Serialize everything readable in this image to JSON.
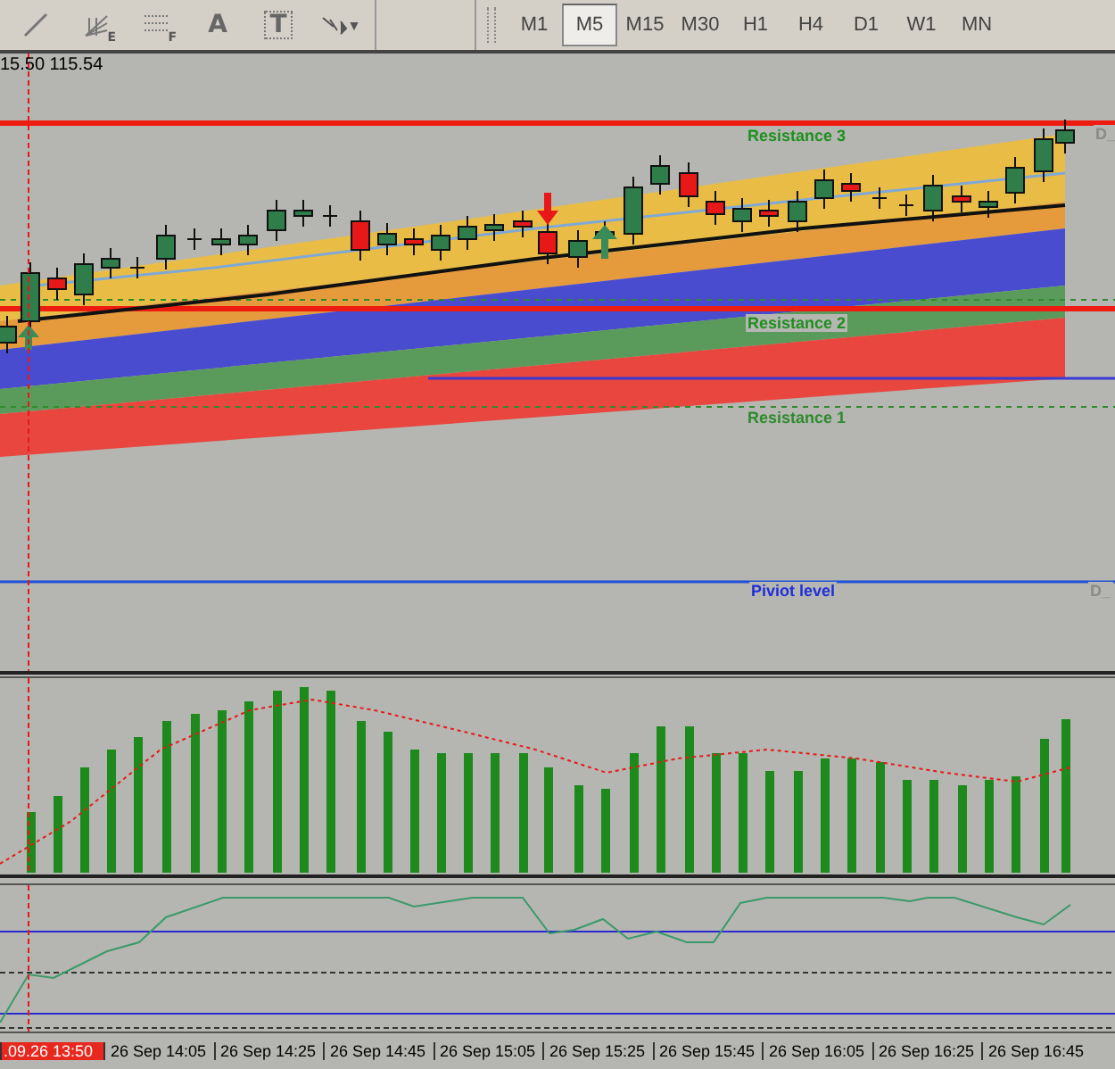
{
  "toolbar": {
    "tools": [
      {
        "kind": "line"
      },
      {
        "kind": "fan",
        "subscript": "E"
      },
      {
        "kind": "fibo",
        "subscript": "F"
      },
      {
        "kind": "text",
        "label": "A"
      },
      {
        "kind": "label",
        "label": "T"
      },
      {
        "kind": "arrows"
      }
    ],
    "timeframes": [
      {
        "label": "M1",
        "selected": false
      },
      {
        "label": "M5",
        "selected": true
      },
      {
        "label": "M15",
        "selected": false
      },
      {
        "label": "M30",
        "selected": false
      },
      {
        "label": "H1",
        "selected": false
      },
      {
        "label": "H4",
        "selected": false
      },
      {
        "label": "D1",
        "selected": false
      },
      {
        "label": "W1",
        "selected": false
      },
      {
        "label": "MN",
        "selected": false
      }
    ]
  },
  "chart": {
    "price_header": "15.50 115.54",
    "level_labels": [
      {
        "text": "Resistance 3",
        "color": "#1f8f1f"
      },
      {
        "text": "Resistance 2",
        "color": "#1f8f1f"
      },
      {
        "text": "Resistance 1",
        "color": "#2e8b2e"
      },
      {
        "text": "Piviot level",
        "color": "#1f2fd8"
      },
      {
        "text": "D_",
        "color": "#8a8a8a"
      },
      {
        "text": "D_",
        "color": "#8a8a8a"
      }
    ]
  },
  "time_axis": [
    {
      "label": ".09.26 13:50",
      "highlighted": true
    },
    {
      "label": "26 Sep 14:05",
      "highlighted": false
    },
    {
      "label": "26 Sep 14:25",
      "highlighted": false
    },
    {
      "label": "26 Sep 14:45",
      "highlighted": false
    },
    {
      "label": "26 Sep 15:05",
      "highlighted": false
    },
    {
      "label": "26 Sep 15:25",
      "highlighted": false
    },
    {
      "label": "26 Sep 15:45",
      "highlighted": false
    },
    {
      "label": "26 Sep 16:05",
      "highlighted": false
    },
    {
      "label": "26 Sep 16:25",
      "highlighted": false
    },
    {
      "label": "26 Sep 16:45",
      "highlighted": false
    }
  ]
}
